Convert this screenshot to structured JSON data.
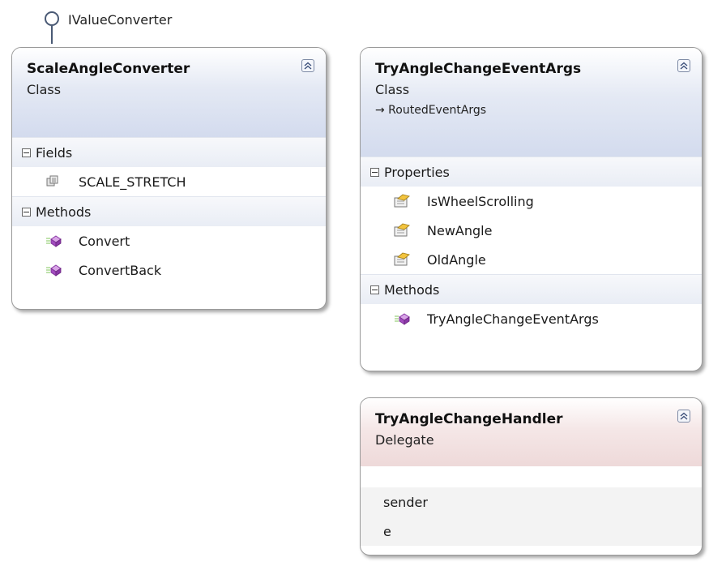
{
  "interface_lollipop": {
    "label": "IValueConverter"
  },
  "shapes": {
    "scale_angle_converter": {
      "title": "ScaleAngleConverter",
      "kind": "Class",
      "sections": {
        "fields": {
          "label": "Fields",
          "items": [
            "SCALE_STRETCH"
          ]
        },
        "methods": {
          "label": "Methods",
          "items": [
            "Convert",
            "ConvertBack"
          ]
        }
      }
    },
    "try_angle_change_event_args": {
      "title": "TryAngleChangeEventArgs",
      "kind": "Class",
      "base": "→ RoutedEventArgs",
      "sections": {
        "properties": {
          "label": "Properties",
          "items": [
            "IsWheelScrolling",
            "NewAngle",
            "OldAngle"
          ]
        },
        "methods": {
          "label": "Methods",
          "items": [
            "TryAngleChangeEventArgs"
          ]
        }
      }
    },
    "try_angle_change_handler": {
      "title": "TryAngleChangeHandler",
      "kind": "Delegate",
      "parameters": [
        "sender",
        "e"
      ]
    }
  },
  "colors": {
    "class_header": "#d3dbee",
    "delegate_header": "#eed9d9",
    "method_icon": "#b25ec9",
    "property_icon": "#e0b43a"
  },
  "icons": {
    "collapse": "double-chevron-up-icon",
    "field": "field-icon",
    "method": "method-icon",
    "property": "property-icon",
    "interface": "interface-lollipop-icon"
  }
}
